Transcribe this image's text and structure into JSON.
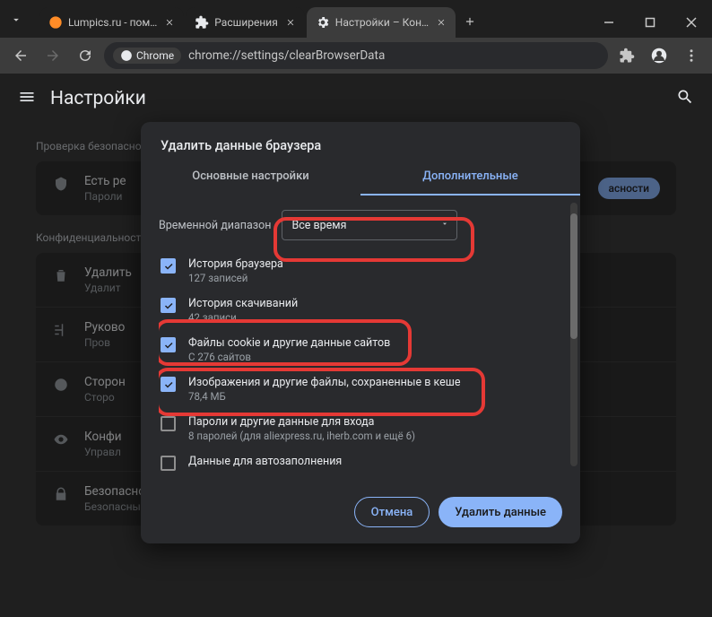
{
  "tabs": {
    "t0": "Lumpics.ru - пом…",
    "t1": "Расширения",
    "t2": "Настройки – Кон…"
  },
  "omnibox": {
    "chip": "Chrome",
    "url": "chrome://settings/clearBrowserData"
  },
  "page": {
    "title": "Настройки",
    "sec_check": "Проверка безопасности",
    "check_t1": "Есть ре",
    "check_t2": "Пароли",
    "check_action": "асности",
    "sec_privacy": "Конфиденциальность",
    "rows": {
      "r0_t1": "Удалить",
      "r0_t2": "Удалит",
      "r1_t1": "Руково",
      "r1_t2": "Пров",
      "r2_t1": "Сторон",
      "r2_t2": "Сторо",
      "r3_t1": "Конфи",
      "r3_t2": "Управл",
      "r4_t1": "Безопасность",
      "r4_t2": "Безопасный просмотр (защита от опасных сайтов) и другие настройки безопасности"
    }
  },
  "dialog": {
    "title": "Удалить данные браузера",
    "tab_basic": "Основные настройки",
    "tab_adv": "Дополнительные",
    "range_label": "Временной диапазон",
    "range_value": "Все время",
    "opts": {
      "o0_t1": "История браузера",
      "o0_t2": "127 записей",
      "o1_t1": "История скачиваний",
      "o1_t2": "42 записи",
      "o2_t1": "Файлы cookie и другие данные сайтов",
      "o2_t2": "С 276 сайтов",
      "o3_t1": "Изображения и другие файлы, сохраненные в кеше",
      "o3_t2": "78,4 МБ",
      "o4_t1": "Пароли и другие данные для входа",
      "o4_t2": "8 паролей (для aliexpress.ru, iherb.com и ещё 6)",
      "o5_t1": "Данные для автозаполнения"
    },
    "cancel": "Отмена",
    "confirm": "Удалить данные"
  }
}
